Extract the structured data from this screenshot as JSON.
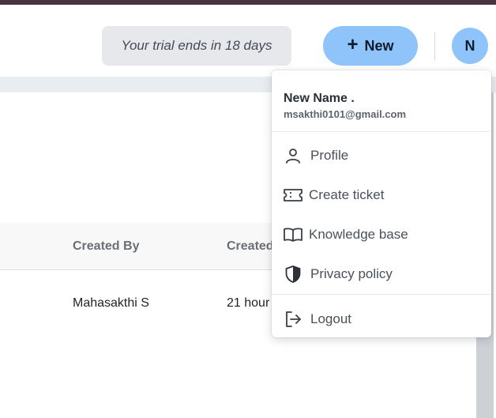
{
  "header": {
    "trial_text": "Your trial ends in 18 days",
    "new_button_label": "New",
    "avatar_initial": "N"
  },
  "table": {
    "columns": [
      "Created By",
      "Created"
    ],
    "rows": [
      {
        "created_by": "Mahasakthi S",
        "created": "21 hour"
      }
    ]
  },
  "user_menu": {
    "name": "New Name .",
    "email": "msakthi0101@gmail.com",
    "items": [
      {
        "label": "Profile",
        "icon": "person-icon"
      },
      {
        "label": "Create ticket",
        "icon": "ticket-icon"
      },
      {
        "label": "Knowledge base",
        "icon": "book-icon"
      },
      {
        "label": "Privacy policy",
        "icon": "shield-icon"
      },
      {
        "label": "Logout",
        "icon": "logout-icon"
      }
    ]
  },
  "colors": {
    "accent": "#8fc4fb",
    "top_strip": "#4a3340",
    "banner_bg": "#e6e8ec"
  }
}
